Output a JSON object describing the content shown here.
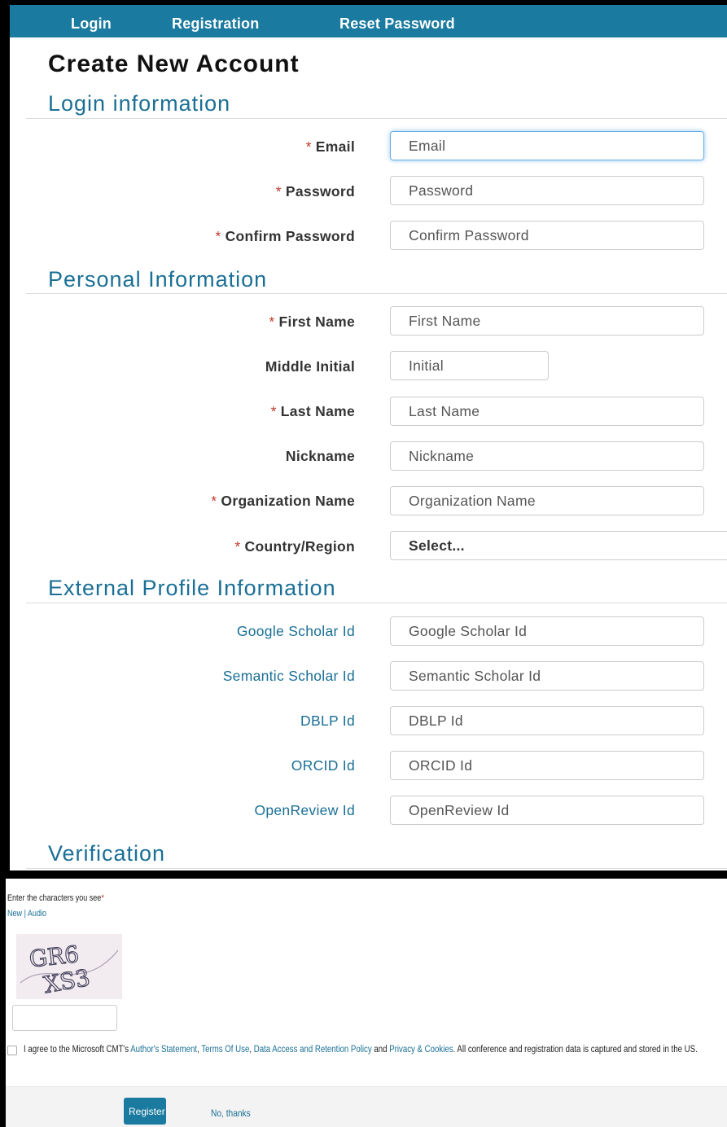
{
  "nav": {
    "login": "Login",
    "registration": "Registration",
    "reset_password": "Reset Password"
  },
  "page_title": "Create New Account",
  "sections": {
    "login": "Login information",
    "personal": "Personal Information",
    "external": "External Profile Information",
    "verification": "Verification"
  },
  "required_marker": "*",
  "login_fields": {
    "email": {
      "label": "Email",
      "placeholder": "Email"
    },
    "password": {
      "label": "Password",
      "placeholder": "Password"
    },
    "confirm_password": {
      "label": "Confirm Password",
      "placeholder": "Confirm Password"
    }
  },
  "personal_fields": {
    "first_name": {
      "label": "First Name",
      "placeholder": "First Name"
    },
    "middle_initial": {
      "label": "Middle Initial",
      "placeholder": "Initial"
    },
    "last_name": {
      "label": "Last Name",
      "placeholder": "Last Name"
    },
    "nickname": {
      "label": "Nickname",
      "placeholder": "Nickname"
    },
    "organization": {
      "label": "Organization Name",
      "placeholder": "Organization Name"
    },
    "country": {
      "label": "Country/Region",
      "value": "Select..."
    }
  },
  "external_fields": {
    "google_scholar": {
      "label": "Google Scholar Id",
      "placeholder": "Google Scholar Id"
    },
    "semantic_scholar": {
      "label": "Semantic Scholar Id",
      "placeholder": "Semantic Scholar Id"
    },
    "dblp": {
      "label": "DBLP Id",
      "placeholder": "DBLP Id"
    },
    "orcid": {
      "label": "ORCID Id",
      "placeholder": "ORCID Id"
    },
    "openreview": {
      "label": "OpenReview Id",
      "placeholder": "OpenReview Id"
    }
  },
  "verification": {
    "prompt": "Enter the characters you see",
    "new_link": "New",
    "separator": "|",
    "audio_link": "Audio",
    "captcha_text_line1": "GR6",
    "captcha_text_line2": "XS3"
  },
  "agreement": {
    "prefix": "I agree to the Microsoft CMT's",
    "authors_statement": "Author's Statement",
    "terms": "Terms Of Use",
    "data_policy": "Data Access and Retention Policy",
    "and": "and",
    "privacy": "Privacy & Cookies",
    "suffix": ". All conference and registration data is captured and stored in the US."
  },
  "buttons": {
    "register": "Register",
    "no_thanks": "No, thanks"
  },
  "colors": {
    "nav_bg": "#1a7a9f",
    "section_heading": "#1a6f95",
    "required": "#c0392b"
  }
}
